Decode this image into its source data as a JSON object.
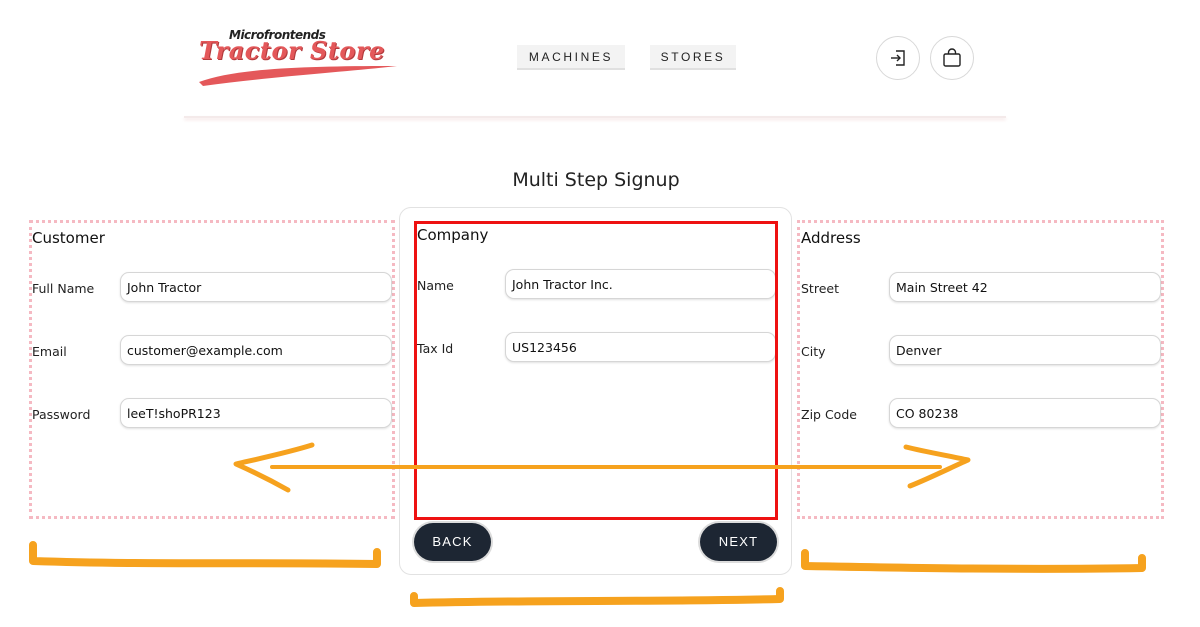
{
  "header": {
    "logo_small": "Microfrontends",
    "logo_big": "Tractor Store",
    "nav": [
      "MACHINES",
      "STORES"
    ],
    "icons": [
      "login-icon",
      "shopping-bag-icon"
    ]
  },
  "page_title": "Multi Step Signup",
  "customer": {
    "title": "Customer",
    "fields": [
      {
        "label": "Full Name",
        "value": "John Tractor"
      },
      {
        "label": "Email",
        "value": "customer@example.com"
      },
      {
        "label": "Password",
        "value": "leeT!shoPR123"
      }
    ]
  },
  "company": {
    "title": "Company",
    "fields": [
      {
        "label": "Name",
        "value": "John Tractor Inc."
      },
      {
        "label": "Tax Id",
        "value": "US123456"
      }
    ],
    "back_label": "BACK",
    "next_label": "NEXT"
  },
  "address": {
    "title": "Address",
    "fields": [
      {
        "label": "Street",
        "value": "Main Street 42"
      },
      {
        "label": "City",
        "value": "Denver"
      },
      {
        "label": "Zip Code",
        "value": "CO 80238"
      }
    ]
  },
  "colors": {
    "brand": "#e4585a",
    "highlight": "#ee1111",
    "annotation": "#f6a21e",
    "button": "#1d2633",
    "dotted_border": "#f5b9c2"
  }
}
